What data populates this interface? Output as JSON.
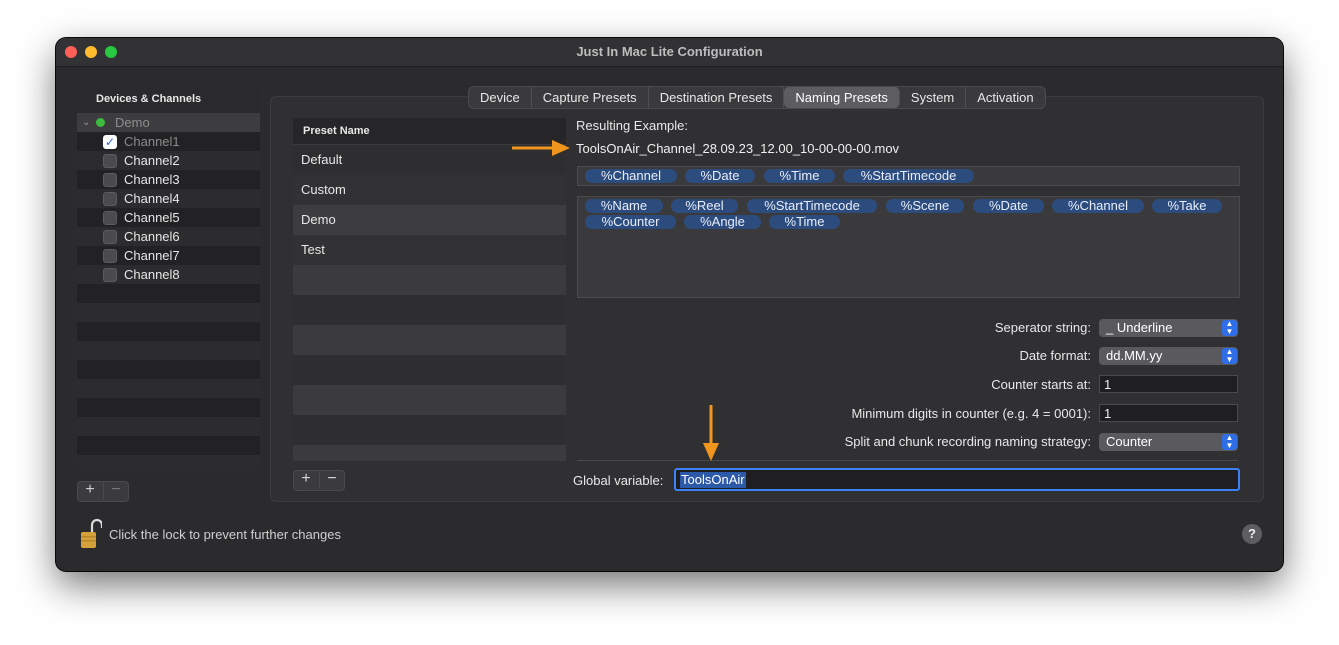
{
  "window": {
    "title": "Just In Mac Lite Configuration"
  },
  "sidebar": {
    "header": "Devices & Channels",
    "device": "Demo",
    "channels": [
      {
        "label": "Channel1",
        "checked": true
      },
      {
        "label": "Channel2",
        "checked": false
      },
      {
        "label": "Channel3",
        "checked": false
      },
      {
        "label": "Channel4",
        "checked": false
      },
      {
        "label": "Channel5",
        "checked": false
      },
      {
        "label": "Channel6",
        "checked": false
      },
      {
        "label": "Channel7",
        "checked": false
      },
      {
        "label": "Channel8",
        "checked": false
      }
    ],
    "add_label": "+",
    "remove_label": "−"
  },
  "tabs": [
    "Device",
    "Capture Presets",
    "Destination Presets",
    "Naming Presets",
    "System",
    "Activation"
  ],
  "presets": {
    "header": "Preset Name",
    "items": [
      "Default",
      "Custom",
      "Demo",
      "Test"
    ],
    "selected": "Demo",
    "add_label": "+",
    "remove_label": "−"
  },
  "result": {
    "label": "Resulting Example:",
    "value": "ToolsOnAir_Channel_28.09.23_12.00_10-00-00-00.mov"
  },
  "pattern_tokens": [
    "%Channel",
    "%Date",
    "%Time",
    "%StartTimecode"
  ],
  "available_tokens": [
    "%Name",
    "%Reel",
    "%StartTimecode",
    "%Scene",
    "%Date",
    "%Channel",
    "%Take",
    "%Counter",
    "%Angle",
    "%Time"
  ],
  "form": {
    "separator_label": "Seperator string:",
    "separator_value": "_ Underline",
    "date_format_label": "Date format:",
    "date_format_value": "dd.MM.yy",
    "counter_start_label": "Counter starts at:",
    "counter_start_value": "1",
    "min_digits_label": "Minimum digits in counter (e.g. 4 = 0001):",
    "min_digits_value": "1",
    "split_label": "Split and chunk recording naming strategy:",
    "split_value": "Counter"
  },
  "global": {
    "label": "Global variable:",
    "value": "ToolsOnAir"
  },
  "footer": {
    "lock_label": "Click the lock to prevent further changes",
    "help_label": "?"
  },
  "colors": {
    "annotation_arrow": "#f0961f",
    "accent": "#2f6ee6",
    "token": "#2d4c7e"
  }
}
